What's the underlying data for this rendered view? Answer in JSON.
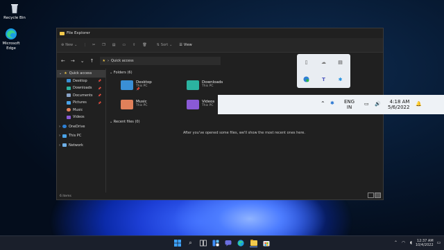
{
  "desktop": {
    "icons": [
      {
        "label": "Recycle Bin",
        "icon": "recycle-bin-icon"
      },
      {
        "label": "Microsoft Edge",
        "icon": "edge-icon"
      }
    ]
  },
  "explorer": {
    "title": "File Explorer",
    "toolbar": {
      "new_label": "New",
      "sort_label": "Sort",
      "view_label": "View"
    },
    "address": {
      "path": "Quick access"
    },
    "nav": [
      {
        "label": "Quick access",
        "selected": true
      },
      {
        "label": "Desktop",
        "pinned": true
      },
      {
        "label": "Downloads",
        "pinned": true
      },
      {
        "label": "Documents",
        "pinned": true
      },
      {
        "label": "Pictures",
        "pinned": true
      },
      {
        "label": "Music"
      },
      {
        "label": "Videos"
      },
      {
        "label": "OneDrive"
      },
      {
        "label": "This PC"
      },
      {
        "label": "Network"
      }
    ],
    "folders_header": "Folders (6)",
    "folders": [
      {
        "name": "Desktop",
        "sub": "This PC",
        "color": "#3a8fd6"
      },
      {
        "name": "Downloads",
        "sub": "This PC",
        "color": "#2bb3a0"
      },
      {
        "name": "Music",
        "sub": "This PC",
        "color": "#e0805a"
      },
      {
        "name": "Videos",
        "sub": "This PC",
        "color": "#8a5ad6"
      }
    ],
    "recent_header": "Recent files (0)",
    "recent_empty": "After you've opened some files, we'll show the most recent ones here.",
    "status": "6 items"
  },
  "tray_bar": {
    "lang_line1": "ENG",
    "lang_line2": "IN",
    "time": "4:18 AM",
    "date": "5/6/2022"
  },
  "taskbar": {
    "time": "12:37 AM",
    "date": "10/4/2022"
  },
  "colors": {
    "accent": "#0067c0",
    "tray_bg": "#eef2f6",
    "explorer_bg": "#202020"
  }
}
